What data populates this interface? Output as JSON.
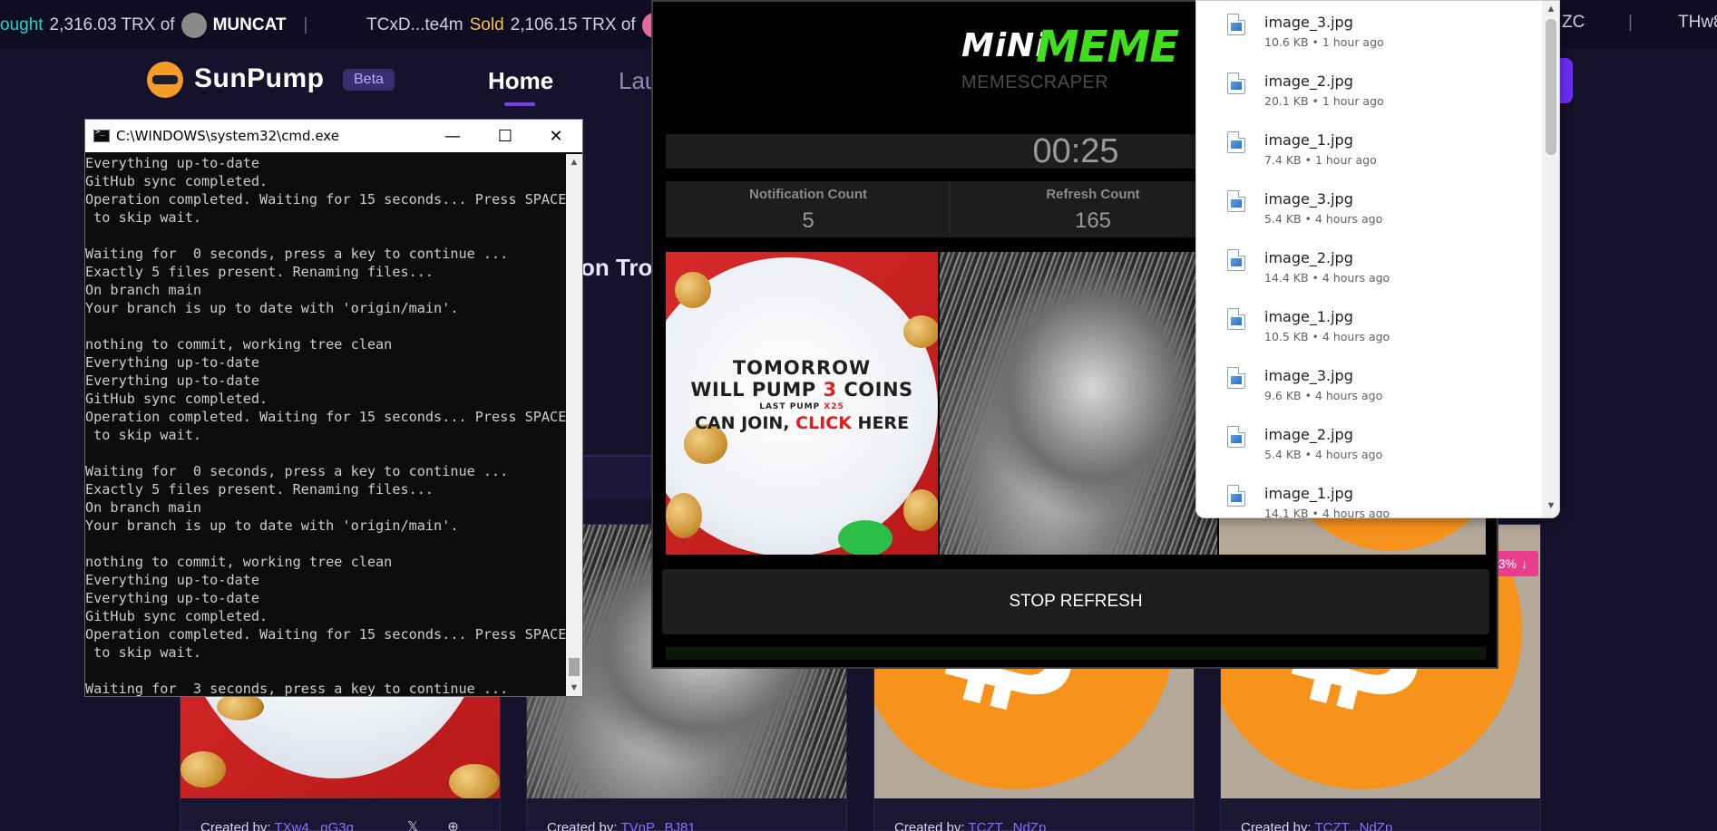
{
  "ticker": {
    "item1_action": "ought",
    "item1_amount": "2,316.03 TRX of",
    "item1_name": "MUNCAT",
    "item2_addr": "TCxD...te4m",
    "item2_action": "Sold",
    "item2_amount": "2,106.15 TRX of",
    "item3_fragment": "ZC",
    "item4_addr": "THw8"
  },
  "sunpump": {
    "brand": "SunPump",
    "beta": "Beta",
    "nav_home": "Home",
    "nav_launch": "Lau",
    "hero_text": "on Tro",
    "cards": [
      {
        "created_label": "Created by:",
        "creator": "TXw4...gG3g"
      },
      {
        "created_label": "Created by:",
        "creator": "TVnP...BJ81"
      },
      {
        "created_label": "Created by:",
        "creator": "TCZT...NdZp"
      },
      {
        "created_label": "Created by:",
        "creator": "TCZT...NdZp"
      }
    ],
    "pct_badge": "3%",
    "socials": "𝕏 ⊕ ➤"
  },
  "cmd": {
    "title": "C:\\WINDOWS\\system32\\cmd.exe",
    "lines": "Everything up-to-date\nGitHub sync completed.\nOperation completed. Waiting for 15 seconds... Press SPACE\n to skip wait.\n\nWaiting for  0 seconds, press a key to continue ...\nExactly 5 files present. Renaming files...\nOn branch main\nYour branch is up to date with 'origin/main'.\n\nnothing to commit, working tree clean\nEverything up-to-date\nEverything up-to-date\nGitHub sync completed.\nOperation completed. Waiting for 15 seconds... Press SPACE\n to skip wait.\n\nWaiting for  0 seconds, press a key to continue ...\nExactly 5 files present. Renaming files...\nOn branch main\nYour branch is up to date with 'origin/main'.\n\nnothing to commit, working tree clean\nEverything up-to-date\nEverything up-to-date\nGitHub sync completed.\nOperation completed. Waiting for 15 seconds... Press SPACE\n to skip wait.\n\nWaiting for  3 seconds, press a key to continue ...",
    "min_icon": "—",
    "max_icon": "☐",
    "close_icon": "✕"
  },
  "minimeme": {
    "logo_mini": "MiNi",
    "logo_meme": "MEME",
    "subtitle": "MEMESCRAPER",
    "timer": "00:25",
    "stats": [
      {
        "label": "Notification Count",
        "value": "5"
      },
      {
        "label": "Refresh Count",
        "value": "165"
      }
    ],
    "promo": {
      "line1": "TOMORROW",
      "line2_a": "WILL PUMP ",
      "line2_b": "3",
      "line2_c": " COINS",
      "line3_a": "LAST PUMP ",
      "line3_b": "X25",
      "line4_a": "CAN JOIN, ",
      "line4_b": "CLICK",
      "line4_c": " HERE"
    },
    "stop_button": "STOP REFRESH"
  },
  "downloads": [
    {
      "name": "image_3.jpg",
      "meta": "10.6 KB • 1 hour ago"
    },
    {
      "name": "image_2.jpg",
      "meta": "20.1 KB • 1 hour ago"
    },
    {
      "name": "image_1.jpg",
      "meta": "7.4 KB • 1 hour ago"
    },
    {
      "name": "image_3.jpg",
      "meta": "5.4 KB • 4 hours ago"
    },
    {
      "name": "image_2.jpg",
      "meta": "14.4 KB • 4 hours ago"
    },
    {
      "name": "image_1.jpg",
      "meta": "10.5 KB • 4 hours ago"
    },
    {
      "name": "image_3.jpg",
      "meta": "9.6 KB • 4 hours ago"
    },
    {
      "name": "image_2.jpg",
      "meta": "5.4 KB • 4 hours ago"
    },
    {
      "name": "image_1.jpg",
      "meta": "14.1 KB • 4 hours ago"
    }
  ],
  "colors": {
    "accent": "#6d2df5",
    "green": "#41e01f",
    "btc": "#f7931a"
  }
}
